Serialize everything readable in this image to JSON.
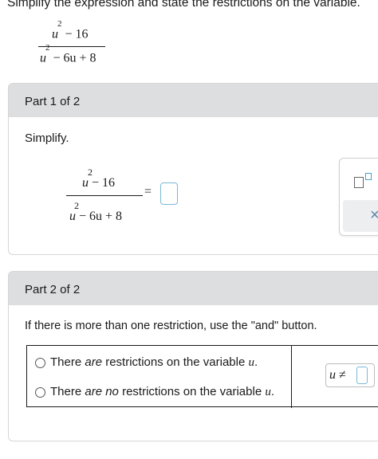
{
  "prompt": "Simplify the expression and state the restrictions on the variable.",
  "expression": {
    "numerator": {
      "var": "u",
      "exp": "2",
      "rest": " − 16"
    },
    "denominator": {
      "var": "u",
      "exp": "2",
      "rest": " − 6u + 8"
    }
  },
  "part1": {
    "header": "Part 1 of 2",
    "instruction": "Simplify.",
    "numerator": {
      "exp": "2",
      "var": "u",
      "rest": "  −  16"
    },
    "denominator": {
      "exp": "2",
      "var": "u",
      "rest": "  −  6u  +  8"
    },
    "equals": "=",
    "answer_value": ""
  },
  "toolbox": {
    "exponent_tool": "superscript-template-icon",
    "clear_label": "×"
  },
  "part2": {
    "header": "Part 2 of 2",
    "instruction": "If there is more than one restriction, use the \"and\" button.",
    "options": [
      {
        "pre": "There ",
        "em": "are",
        "post": " restrictions on the variable ",
        "var": "u",
        "end": "."
      },
      {
        "pre": "There ",
        "em": "are no",
        "post": " restrictions on the variable ",
        "var": "u",
        "end": "."
      }
    ],
    "restriction": {
      "var": "u",
      "symbol": "≠",
      "value": ""
    }
  }
}
